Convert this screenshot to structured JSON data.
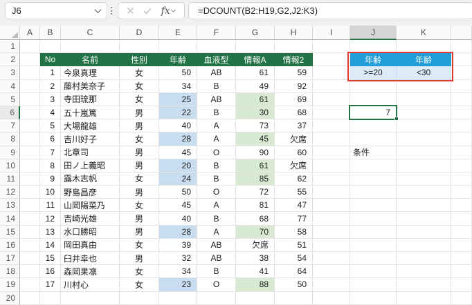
{
  "formula_bar": {
    "cell_reference": "J6",
    "formula": "=DCOUNT(B2:H19,G2,J2:K3)",
    "fx_label": "fx"
  },
  "grid": {
    "column_letters": [
      "A",
      "B",
      "C",
      "D",
      "E",
      "F",
      "G",
      "H",
      "I",
      "J",
      "K"
    ],
    "visible_rows": 20,
    "selected_column": "J",
    "selected_row": 6
  },
  "data_table": {
    "headers": [
      "No",
      "名前",
      "性別",
      "年齢",
      "血液型",
      "情報A",
      "情報2"
    ],
    "rows": [
      {
        "no": "1",
        "name": "今泉真理",
        "gender": "女",
        "age": "50",
        "blood_type": "AB",
        "info_a": "61",
        "info_2": "59",
        "highlighted": false
      },
      {
        "no": "2",
        "name": "藤村美奈子",
        "gender": "女",
        "age": "34",
        "blood_type": "B",
        "info_a": "49",
        "info_2": "92",
        "highlighted": false
      },
      {
        "no": "3",
        "name": "寺田琉那",
        "gender": "女",
        "age": "25",
        "blood_type": "AB",
        "info_a": "61",
        "info_2": "69",
        "highlighted": true
      },
      {
        "no": "4",
        "name": "五十嵐篤",
        "gender": "男",
        "age": "22",
        "blood_type": "B",
        "info_a": "30",
        "info_2": "68",
        "highlighted": true
      },
      {
        "no": "5",
        "name": "大場龍雄",
        "gender": "男",
        "age": "40",
        "blood_type": "A",
        "info_a": "73",
        "info_2": "37",
        "highlighted": false
      },
      {
        "no": "6",
        "name": "吉川好子",
        "gender": "女",
        "age": "28",
        "blood_type": "A",
        "info_a": "45",
        "info_2": "欠席",
        "highlighted": true
      },
      {
        "no": "7",
        "name": "北章司",
        "gender": "男",
        "age": "45",
        "blood_type": "O",
        "info_a": "90",
        "info_2": "60",
        "highlighted": false
      },
      {
        "no": "8",
        "name": "田ノ上義昭",
        "gender": "男",
        "age": "20",
        "blood_type": "B",
        "info_a": "61",
        "info_2": "欠席",
        "highlighted": true
      },
      {
        "no": "9",
        "name": "露木志帆",
        "gender": "女",
        "age": "24",
        "blood_type": "B",
        "info_a": "85",
        "info_2": "62",
        "highlighted": true
      },
      {
        "no": "10",
        "name": "野島昌彦",
        "gender": "男",
        "age": "50",
        "blood_type": "O",
        "info_a": "72",
        "info_2": "55",
        "highlighted": false
      },
      {
        "no": "11",
        "name": "山岡陽菜乃",
        "gender": "女",
        "age": "45",
        "blood_type": "A",
        "info_a": "81",
        "info_2": "47",
        "highlighted": false
      },
      {
        "no": "12",
        "name": "吉崎光雄",
        "gender": "男",
        "age": "40",
        "blood_type": "B",
        "info_a": "68",
        "info_2": "77",
        "highlighted": false
      },
      {
        "no": "13",
        "name": "水口勝昭",
        "gender": "男",
        "age": "28",
        "blood_type": "A",
        "info_a": "70",
        "info_2": "58",
        "highlighted": true
      },
      {
        "no": "14",
        "name": "岡田真由",
        "gender": "女",
        "age": "39",
        "blood_type": "AB",
        "info_a": "欠席",
        "info_2": "51",
        "highlighted": false
      },
      {
        "no": "15",
        "name": "臼井幸也",
        "gender": "男",
        "age": "32",
        "blood_type": "AB",
        "info_a": "38",
        "info_2": "54",
        "highlighted": false
      },
      {
        "no": "16",
        "name": "森岡果凛",
        "gender": "女",
        "age": "34",
        "blood_type": "B",
        "info_a": "41",
        "info_2": "64",
        "highlighted": false
      },
      {
        "no": "17",
        "name": "川村心",
        "gender": "女",
        "age": "23",
        "blood_type": "O",
        "info_a": "88",
        "info_2": "50",
        "highlighted": true
      }
    ]
  },
  "criteria_table": {
    "headers": [
      "年齢",
      "年齢"
    ],
    "values": [
      ">=20",
      "<30"
    ]
  },
  "result_cell": {
    "cell": "J6",
    "value": "7"
  },
  "condition_label": "条件",
  "colors": {
    "table_header_bg": "#217346",
    "criteria_header_bg": "#219ED9",
    "criteria_value_bg": "#DCEBF7",
    "age_highlight_bg": "#C9DDF1",
    "info_highlight_bg": "#D8EBD2",
    "criteria_border": "#E23A2E",
    "active_cell_border": "#217346"
  }
}
